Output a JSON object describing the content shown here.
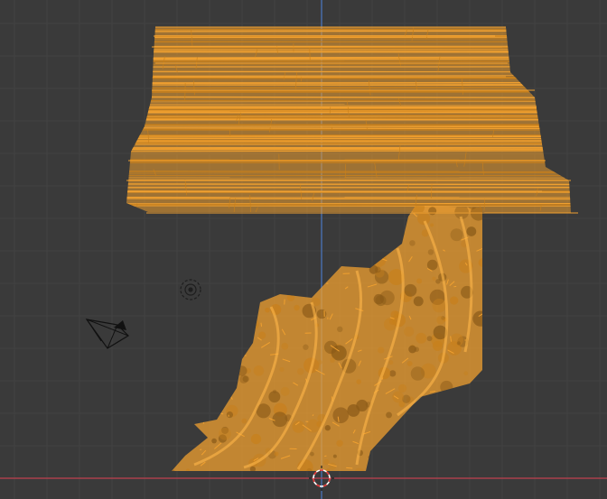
{
  "viewport": {
    "background_color": "#3a3a3a",
    "grid_minor_color": "#424242",
    "grid_major_color": "#4a4a4a",
    "x_axis_color": "#c0424f",
    "y_axis_color": "#4a78c2",
    "selection_color": "#f0a030",
    "selection_dark_color": "#c8801c"
  },
  "objects": [
    {
      "name": "terrain-mesh",
      "type": "mesh",
      "selected": true,
      "display": "wireframe"
    },
    {
      "name": "camera",
      "type": "camera",
      "selected": false
    },
    {
      "name": "light",
      "type": "light",
      "selected": false
    },
    {
      "name": "3d-cursor",
      "type": "cursor"
    }
  ]
}
